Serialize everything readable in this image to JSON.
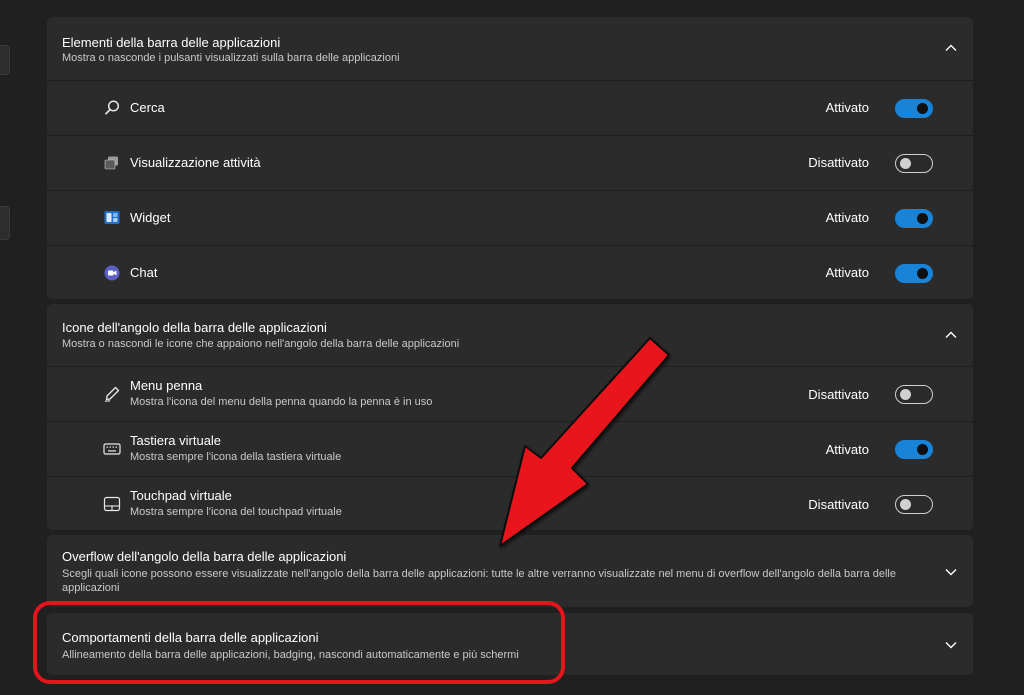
{
  "colors": {
    "accent": "#1883d7",
    "annotation": "#e8141c",
    "card_bg": "#2b2b2b",
    "page_bg": "#202020"
  },
  "taskbar_items": {
    "title": "Elementi della barra delle applicazioni",
    "subtitle": "Mostra o nasconde i pulsanti visualizzati sulla barra delle applicazioni",
    "items": [
      {
        "label": "Cerca",
        "state": "Attivato",
        "on": true,
        "icon": "search-icon"
      },
      {
        "label": "Visualizzazione attività",
        "state": "Disattivato",
        "on": false,
        "icon": "task-view-icon"
      },
      {
        "label": "Widget",
        "state": "Attivato",
        "on": true,
        "icon": "widget-icon"
      },
      {
        "label": "Chat",
        "state": "Attivato",
        "on": true,
        "icon": "chat-icon"
      }
    ]
  },
  "corner_icons": {
    "title": "Icone dell'angolo della barra delle applicazioni",
    "subtitle": "Mostra o nascondi le icone che appaiono nell'angolo della barra delle applicazioni",
    "items": [
      {
        "label": "Menu penna",
        "sub": "Mostra l'icona del menu della penna quando la penna è in uso",
        "state": "Disattivato",
        "on": false,
        "icon": "pen-icon"
      },
      {
        "label": "Tastiera virtuale",
        "sub": "Mostra sempre l'icona della tastiera virtuale",
        "state": "Attivato",
        "on": true,
        "icon": "keyboard-icon"
      },
      {
        "label": "Touchpad virtuale",
        "sub": "Mostra sempre l'icona del touchpad virtuale",
        "state": "Disattivato",
        "on": false,
        "icon": "touchpad-icon"
      }
    ]
  },
  "overflow": {
    "title": "Overflow dell'angolo della barra delle applicazioni",
    "subtitle": "Scegli quali icone possono essere visualizzate nell'angolo della barra delle applicazioni: tutte le altre verranno visualizzate nel menu di overflow dell'angolo della barra delle applicazioni"
  },
  "behaviors": {
    "title": "Comportamenti della barra delle applicazioni",
    "subtitle": "Allineamento della barra delle applicazioni, badging, nascondi automaticamente e più schermi"
  }
}
